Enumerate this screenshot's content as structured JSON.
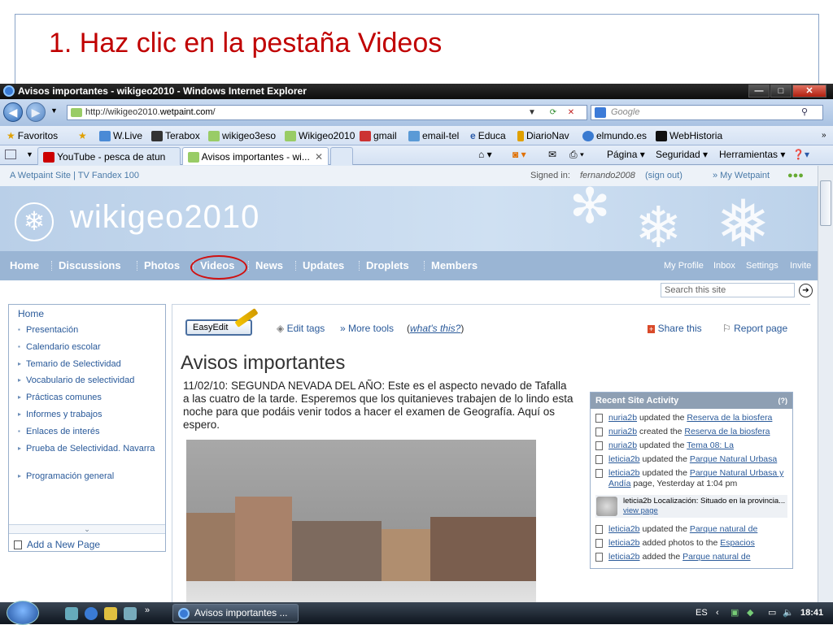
{
  "slide": {
    "title": "1. Haz clic en la pestaña Videos"
  },
  "browser": {
    "window_title": "Avisos importantes - wikigeo2010 - Windows Internet Explorer",
    "url_prefix": "http://wikigeo2010.",
    "url_domain": "wetpaint.com",
    "url_suffix": "/",
    "search_placeholder": "Google",
    "favorites_label": "Favoritos",
    "favorites": [
      "W.Live",
      "Terabox",
      "wikigeo3eso",
      "Wikigeo2010",
      "gmail",
      "email-tel",
      "Educa",
      "DiarioNav",
      "elmundo.es",
      "WebHistoria"
    ],
    "tabs": [
      {
        "label": "YouTube - pesca de atun",
        "active": false
      },
      {
        "label": "Avisos importantes - wi...",
        "active": true
      }
    ],
    "commands": {
      "page": "Página",
      "security": "Seguridad",
      "tools": "Herramientas"
    }
  },
  "site": {
    "top_left": "A Wetpaint Site | TV Fandex 100",
    "signed_in_label": "Signed in:",
    "signed_in_user": "fernando2008",
    "sign_out": "(sign out)",
    "my_wetpaint": "» My Wetpaint",
    "name": "wikigeo2010",
    "nav": [
      "Home",
      "Discussions",
      "Photos",
      "Videos",
      "News",
      "Updates",
      "Droplets",
      "Members"
    ],
    "nav_right": [
      "My Profile",
      "Inbox",
      "Settings",
      "Invite"
    ],
    "search_placeholder": "Search this site"
  },
  "sidebar": {
    "home": "Home",
    "items": [
      "Presentación",
      "Calendario escolar",
      "Temario de Selectividad",
      "Vocabulario de selectividad",
      "Prácticas comunes",
      "Informes y trabajos",
      "Enlaces de interés",
      "Prueba de Selectividad. Navarra",
      "Programación general"
    ],
    "add_page": "Add a New Page"
  },
  "toolbar": {
    "easyedit": "EasyEdit",
    "edit_tags": "Edit tags",
    "more_tools": "» More tools",
    "whats_this_open": "(",
    "whats_this": "what's this?",
    "whats_this_close": ")",
    "share": "Share this",
    "report": "Report page"
  },
  "article": {
    "title": "Avisos importantes",
    "body": "11/02/10: SEGUNDA NEVADA DEL AÑO: Este es el aspecto nevado de Tafalla a las cuatro de la tarde. Esperemos que los quitanieves trabajen de lo lindo esta noche para que podáis venir todos a hacer el examen de Geografía. Aquí os espero."
  },
  "activity": {
    "title": "Recent Site Activity",
    "help": "(?)",
    "rows": [
      {
        "user": "nuria2b",
        "action": "updated the",
        "target": "Reserva de la biosfera"
      },
      {
        "user": "nuria2b",
        "action": "created the",
        "target": "Reserva de la biosfera"
      },
      {
        "user": "nuria2b",
        "action": "updated the",
        "target": "Tema 08: La"
      },
      {
        "user": "leticia2b",
        "action": "updated the",
        "target": "Parque Natural Urbasa"
      },
      {
        "user": "leticia2b",
        "action": "updated the",
        "target": "Parque Natural Urbasa y Andía",
        "extra": "page, Yesterday at 1:04 pm"
      }
    ],
    "preview_text": "leticia2b Localización: Situado en la provincia...",
    "preview_link": "view page",
    "rows_after": [
      {
        "user": "leticia2b",
        "action": "updated the",
        "target": "Parque natural de"
      },
      {
        "user": "leticia2b",
        "action": "added photos to the",
        "target": "Espacios"
      },
      {
        "user": "leticia2b",
        "action": "added the",
        "target": "Parque natural de"
      }
    ]
  },
  "taskbar": {
    "task": "Avisos importantes ...",
    "lang": "ES",
    "time": "18:41"
  }
}
